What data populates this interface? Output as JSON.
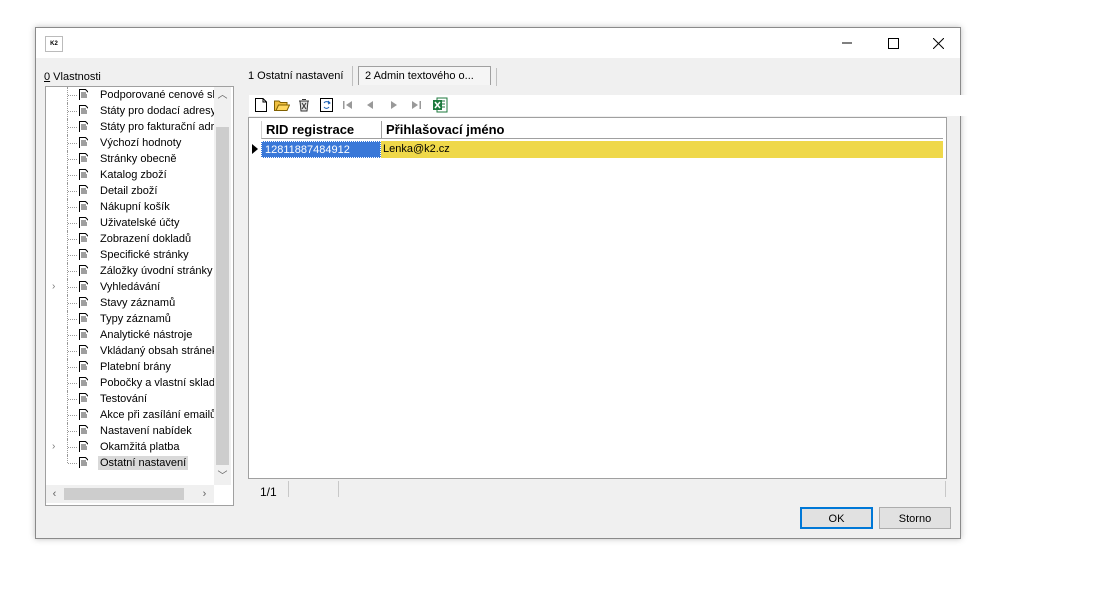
{
  "window": {
    "app_icon_text": "K2",
    "minimize": "—",
    "maximize": "☐",
    "close": "✕"
  },
  "left_panel": {
    "label_hotkey": "0",
    "label_rest": " Vlastnosti",
    "items": [
      {
        "label": "Podporované cenové skup",
        "expandable": false
      },
      {
        "label": "Státy pro dodací adresy",
        "expandable": false
      },
      {
        "label": "Státy pro fakturační adres",
        "expandable": false
      },
      {
        "label": "Výchozí hodnoty",
        "expandable": false
      },
      {
        "label": "Stránky obecně",
        "expandable": false
      },
      {
        "label": "Katalog zboží",
        "expandable": false
      },
      {
        "label": "Detail zboží",
        "expandable": false
      },
      {
        "label": "Nákupní košík",
        "expandable": false
      },
      {
        "label": "Uživatelské účty",
        "expandable": false
      },
      {
        "label": "Zobrazení dokladů",
        "expandable": false
      },
      {
        "label": "Specifické stránky",
        "expandable": false
      },
      {
        "label": "Záložky úvodní stránky",
        "expandable": false
      },
      {
        "label": "Vyhledávání",
        "expandable": true
      },
      {
        "label": "Stavy záznamů",
        "expandable": false
      },
      {
        "label": "Typy záznamů",
        "expandable": false
      },
      {
        "label": "Analytické nástroje",
        "expandable": false
      },
      {
        "label": "Vkládaný obsah stránek",
        "expandable": false
      },
      {
        "label": "Platební brány",
        "expandable": false
      },
      {
        "label": "Pobočky a vlastní sklady",
        "expandable": false
      },
      {
        "label": "Testování",
        "expandable": false
      },
      {
        "label": "Akce při zasílání emailů",
        "expandable": false
      },
      {
        "label": "Nastavení nabídek",
        "expandable": false
      },
      {
        "label": "Okamžitá platba",
        "expandable": true
      },
      {
        "label": "Ostatní nastavení",
        "expandable": false,
        "selected": true
      }
    ]
  },
  "tabs": {
    "tab1": "1 Ostatní nastavení",
    "tab2": "2 Admin textového o..."
  },
  "grid": {
    "columns": [
      "RID registrace",
      "Přihlašovací jméno"
    ],
    "rows": [
      {
        "rid": "12811887484912",
        "login": "Lenka@k2.cz"
      }
    ],
    "row_color": "#efd84a",
    "selected_cell_color": "#3a78d8"
  },
  "status": {
    "page": "1/1"
  },
  "buttons": {
    "ok": "OK",
    "cancel": "Storno"
  }
}
